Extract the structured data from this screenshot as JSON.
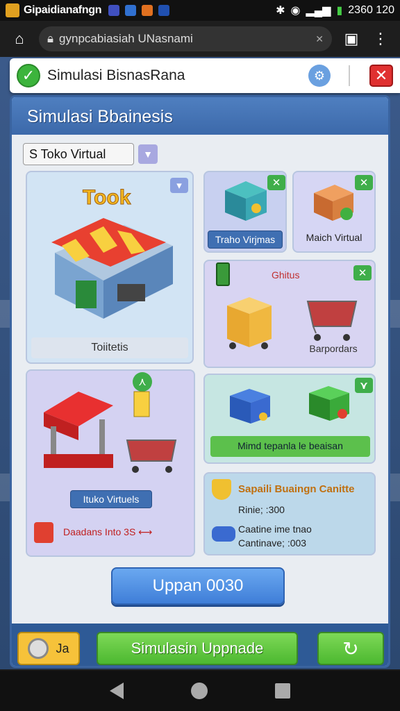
{
  "status": {
    "app_title": "Gipaidianafngn",
    "time": "2360 120"
  },
  "browser": {
    "url": "gynpcabiasiah UNasnami"
  },
  "topbar": {
    "title": "Simulasi BisnasRana"
  },
  "panel": {
    "heading": "Simulasi Bbainesis",
    "dropdown_value": "S  Toko Virtual",
    "main_card": {
      "sign": "Took",
      "label": "Toiitetis"
    },
    "card_a": {
      "label": "Traho Virjmas"
    },
    "card_b": {
      "label": "Maich Virtual"
    },
    "card_c": {
      "top_label": "Ghitus",
      "label": "Barpordars"
    },
    "card_d": {
      "label": "Ituko Virtuels",
      "footer": "Daadans  Into 3S ⟷"
    },
    "card_e": {
      "label": "Mimd tepanla le beaisan"
    },
    "card_f": {
      "title": "Sapaili Buaingn Canitte",
      "line1": "Rinie; :300",
      "line2": "Caatine ime tnao",
      "line3": "Cantinave; :003"
    },
    "upgrade_button": "Uppan 0030"
  },
  "footer": {
    "coin_label": "Ja",
    "sim_button": "Simulasin Uppnade"
  },
  "colors": {
    "accent_blue": "#3c69aa",
    "accent_green": "#4cb830",
    "close_red": "#e03030"
  }
}
